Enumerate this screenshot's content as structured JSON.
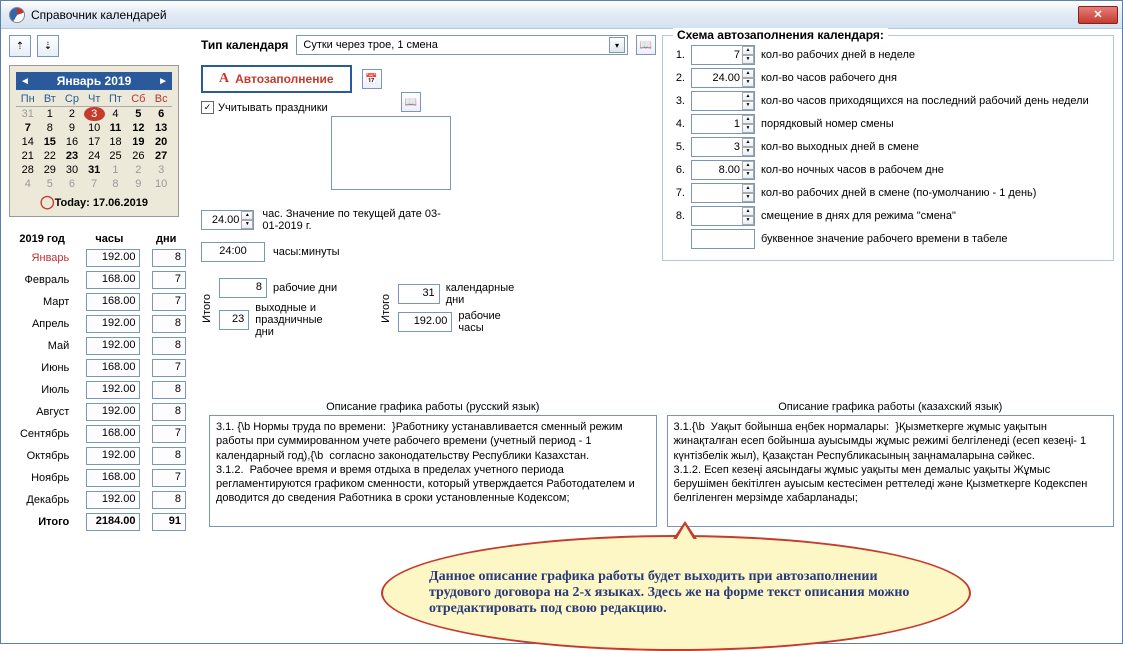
{
  "window": {
    "title": "Справочник календарей"
  },
  "toolbar": {
    "calendar_type_label": "Тип календаря",
    "calendar_type_value": "Сутки через трое, 1 смена"
  },
  "calendar": {
    "month_title": "Январь 2019",
    "weekdays": [
      "Пн",
      "Вт",
      "Ср",
      "Чт",
      "Пт",
      "Сб",
      "Вс"
    ],
    "today_label": "Today: 17.06.2019",
    "selected_day": 3,
    "prev_tail": [
      31
    ],
    "days": [
      1,
      2,
      3,
      4,
      5,
      6,
      7,
      8,
      9,
      10,
      11,
      12,
      13,
      14,
      15,
      16,
      17,
      18,
      19,
      20,
      21,
      22,
      23,
      24,
      25,
      26,
      27,
      28,
      29,
      30,
      31
    ],
    "next_head": [
      1,
      2,
      3,
      4,
      5,
      6,
      7,
      8,
      9,
      10
    ]
  },
  "year_table": {
    "year_label": "2019 год",
    "col_hours": "часы",
    "col_days": "дни",
    "rows": [
      {
        "m": "Январь",
        "h": "192.00",
        "d": "8",
        "sel": true
      },
      {
        "m": "Февраль",
        "h": "168.00",
        "d": "7"
      },
      {
        "m": "Март",
        "h": "168.00",
        "d": "7"
      },
      {
        "m": "Апрель",
        "h": "192.00",
        "d": "8"
      },
      {
        "m": "Май",
        "h": "192.00",
        "d": "8"
      },
      {
        "m": "Июнь",
        "h": "168.00",
        "d": "7"
      },
      {
        "m": "Июль",
        "h": "192.00",
        "d": "8"
      },
      {
        "m": "Август",
        "h": "192.00",
        "d": "8"
      },
      {
        "m": "Сентябрь",
        "h": "168.00",
        "d": "7"
      },
      {
        "m": "Октябрь",
        "h": "192.00",
        "d": "8"
      },
      {
        "m": "Ноябрь",
        "h": "168.00",
        "d": "7"
      },
      {
        "m": "Декабрь",
        "h": "192.00",
        "d": "8"
      }
    ],
    "total_label": "Итого",
    "total_h": "2184.00",
    "total_d": "91"
  },
  "mid": {
    "autofill_label": "Автозаполнение",
    "consider_holidays": "Учитывать праздники",
    "hours_value": "24.00",
    "hours_caption": "час. Значение по текущей дате 03-01-2019 г.",
    "hm_value": "24:00",
    "hm_caption": "часы:минуты",
    "itogo": "Итого",
    "work_days_v": "8",
    "work_days_l": "рабочие дни",
    "off_days_v": "23",
    "off_days_l": "выходные и праздничные дни",
    "cal_days_v": "31",
    "cal_days_l": "календарные дни",
    "work_hours_v": "192.00",
    "work_hours_l": "рабочие часы"
  },
  "schema": {
    "legend": "Схема автозаполнения календаря:",
    "rows": [
      {
        "n": "1.",
        "v": "7",
        "t": "кол-во рабочих дней в неделе"
      },
      {
        "n": "2.",
        "v": "24.00",
        "t": "кол-во часов рабочего дня"
      },
      {
        "n": "3.",
        "v": "",
        "t": "кол-во часов приходящихся на последний рабочий день недели"
      },
      {
        "n": "4.",
        "v": "1",
        "t": "порядковый номер смены"
      },
      {
        "n": "5.",
        "v": "3",
        "t": "кол-во выходных дней в смене"
      },
      {
        "n": "6.",
        "v": "8.00",
        "t": "кол-во ночных часов в рабочем дне"
      },
      {
        "n": "7.",
        "v": "",
        "t": "кол-во рабочих дней в смене (по-умолчанию - 1 день)"
      },
      {
        "n": "8.",
        "v": "",
        "t": "смещение в днях для режима \"смена\""
      }
    ],
    "letter_row": {
      "v": "",
      "t": "буквенное значение рабочего времени в табеле"
    }
  },
  "desc": {
    "ru_head": "Описание графика работы (русский язык)",
    "kz_head": "Описание графика работы (казахский язык)",
    "ru_text": "3.1. {\\b Нормы труда по времени:  }Работнику устанавливается сменный режим работы при суммированном учете рабочего времени (учетный период - 1 календарный год),{\\b  согласно законодательству Республики Казахстан.\n3.1.2.  Рабочее время и время отдыха в пределах учетного периода регламентируются графиком сменности, который утверждается Работодателем и доводится до сведения Работника в сроки установленные Кодексом;",
    "kz_text": "3.1.{\\b  Уақыт бойынша еңбек нормалары:  }Қызметкерге жұмыс уақытын жинақталған есеп бойынша ауысымды жұмыс режимі белгіленеді (есеп кезеңі- 1 күнтізбелік жыл), Қазақстан Республикасының заңнамаларына сәйкес.\n3.1.2. Есеп кезеңі аясындағы жұмыс уақыты мен демалыс уақыты Жұмыс берушімен бекітілген ауысым кестесімен реттеледі және Қызметкерге Кодекспен белгіленген мерзімде хабарланады;"
  },
  "callout": "Данное описание графика работы будет выходить при автозаполнении трудового договора на 2-х языках. Здесь же на форме текст описания можно отредактировать под свою редакцию."
}
